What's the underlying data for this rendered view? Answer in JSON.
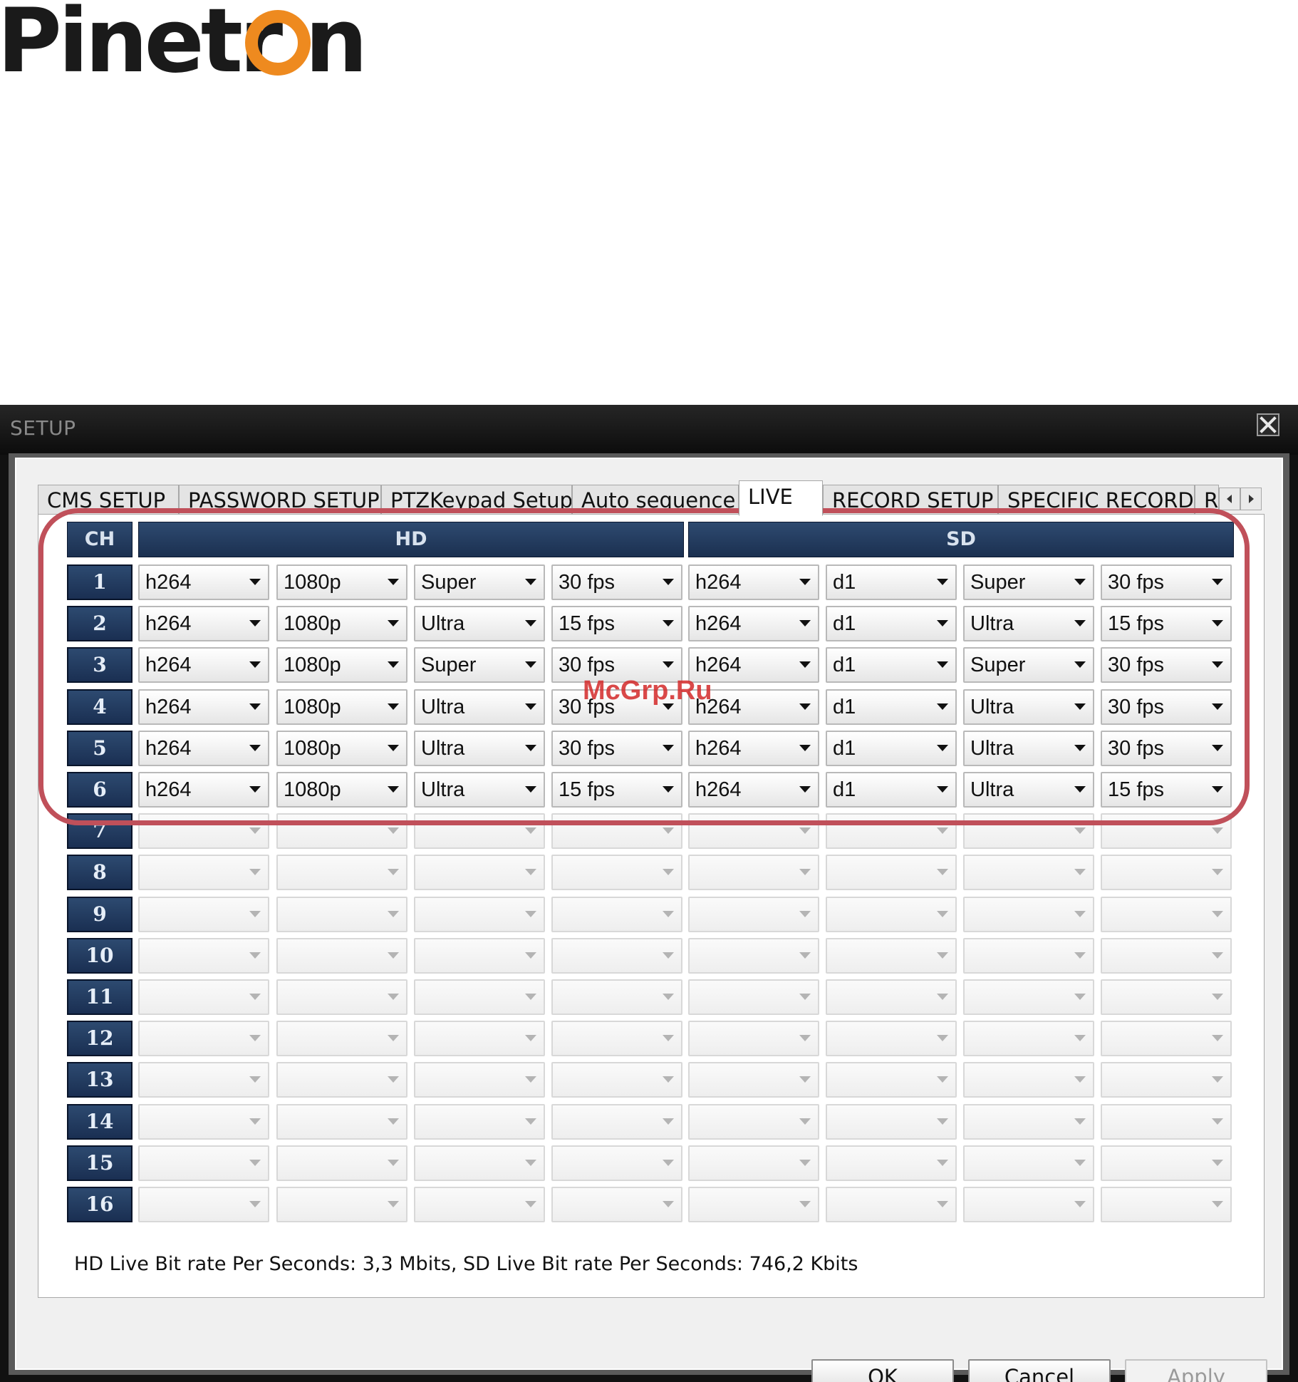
{
  "logo": {
    "text": "Pinetron",
    "colors": {
      "text": "#1a1a1a",
      "ring": "#ee8a1f"
    }
  },
  "window": {
    "title": "SETUP",
    "close_icon": "close-icon"
  },
  "tabs": [
    {
      "label": "CMS SETUP",
      "active": false
    },
    {
      "label": "PASSWORD SETUP",
      "active": false
    },
    {
      "label": "PTZKeypad Setup",
      "active": false
    },
    {
      "label": "Auto sequence",
      "active": false
    },
    {
      "label": "LIVE",
      "active": true
    },
    {
      "label": "RECORD SETUP",
      "active": false
    },
    {
      "label": "SPECIFIC RECORD",
      "active": false
    },
    {
      "label": "R",
      "active": false
    }
  ],
  "tab_scroll": {
    "left_icon": "scroll-left-arrow-icon",
    "right_icon": "scroll-right-arrow-icon"
  },
  "table": {
    "header": {
      "ch": "CH",
      "hd": "HD",
      "sd": "SD"
    },
    "rows": [
      {
        "ch": "1",
        "hd": [
          "h264",
          "1080p",
          "Super",
          "30 fps"
        ],
        "sd": [
          "h264",
          "d1",
          "Super",
          "30 fps"
        ]
      },
      {
        "ch": "2",
        "hd": [
          "h264",
          "1080p",
          "Ultra",
          "15 fps"
        ],
        "sd": [
          "h264",
          "d1",
          "Ultra",
          "15 fps"
        ]
      },
      {
        "ch": "3",
        "hd": [
          "h264",
          "1080p",
          "Super",
          "30 fps"
        ],
        "sd": [
          "h264",
          "d1",
          "Super",
          "30 fps"
        ]
      },
      {
        "ch": "4",
        "hd": [
          "h264",
          "1080p",
          "Ultra",
          "30 fps"
        ],
        "sd": [
          "h264",
          "d1",
          "Ultra",
          "30 fps"
        ]
      },
      {
        "ch": "5",
        "hd": [
          "h264",
          "1080p",
          "Ultra",
          "30 fps"
        ],
        "sd": [
          "h264",
          "d1",
          "Ultra",
          "30 fps"
        ]
      },
      {
        "ch": "6",
        "hd": [
          "h264",
          "1080p",
          "Ultra",
          "15 fps"
        ],
        "sd": [
          "h264",
          "d1",
          "Ultra",
          "15 fps"
        ]
      },
      {
        "ch": "7",
        "hd": [
          "",
          "",
          "",
          ""
        ],
        "sd": [
          "",
          "",
          "",
          ""
        ]
      },
      {
        "ch": "8",
        "hd": [
          "",
          "",
          "",
          ""
        ],
        "sd": [
          "",
          "",
          "",
          ""
        ]
      },
      {
        "ch": "9",
        "hd": [
          "",
          "",
          "",
          ""
        ],
        "sd": [
          "",
          "",
          "",
          ""
        ]
      },
      {
        "ch": "10",
        "hd": [
          "",
          "",
          "",
          ""
        ],
        "sd": [
          "",
          "",
          "",
          ""
        ]
      },
      {
        "ch": "11",
        "hd": [
          "",
          "",
          "",
          ""
        ],
        "sd": [
          "",
          "",
          "",
          ""
        ]
      },
      {
        "ch": "12",
        "hd": [
          "",
          "",
          "",
          ""
        ],
        "sd": [
          "",
          "",
          "",
          ""
        ]
      },
      {
        "ch": "13",
        "hd": [
          "",
          "",
          "",
          ""
        ],
        "sd": [
          "",
          "",
          "",
          ""
        ]
      },
      {
        "ch": "14",
        "hd": [
          "",
          "",
          "",
          ""
        ],
        "sd": [
          "",
          "",
          "",
          ""
        ]
      },
      {
        "ch": "15",
        "hd": [
          "",
          "",
          "",
          ""
        ],
        "sd": [
          "",
          "",
          "",
          ""
        ]
      },
      {
        "ch": "16",
        "hd": [
          "",
          "",
          "",
          ""
        ],
        "sd": [
          "",
          "",
          "",
          ""
        ]
      }
    ]
  },
  "bitrate_text": "HD Live Bit rate Per Seconds: 3,3 Mbits, SD Live Bit rate Per Seconds: 746,2 Kbits",
  "buttons": {
    "ok": "OK",
    "cancel": "Cancel",
    "apply": "Apply"
  },
  "watermark": "McGrp.Ru",
  "colors": {
    "header_blue": "#1f3658",
    "highlight": "#c0505a",
    "watermark": "#d42a2a"
  }
}
